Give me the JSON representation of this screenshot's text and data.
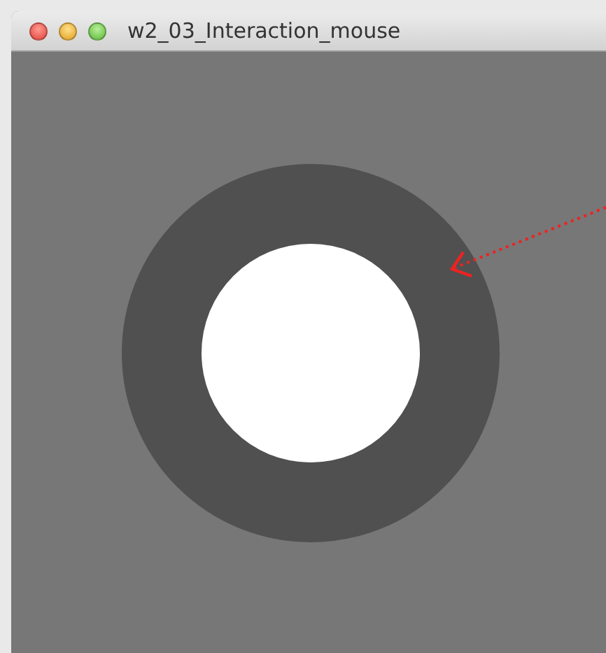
{
  "window": {
    "title": "w2_03_Interaction_mouse"
  }
}
